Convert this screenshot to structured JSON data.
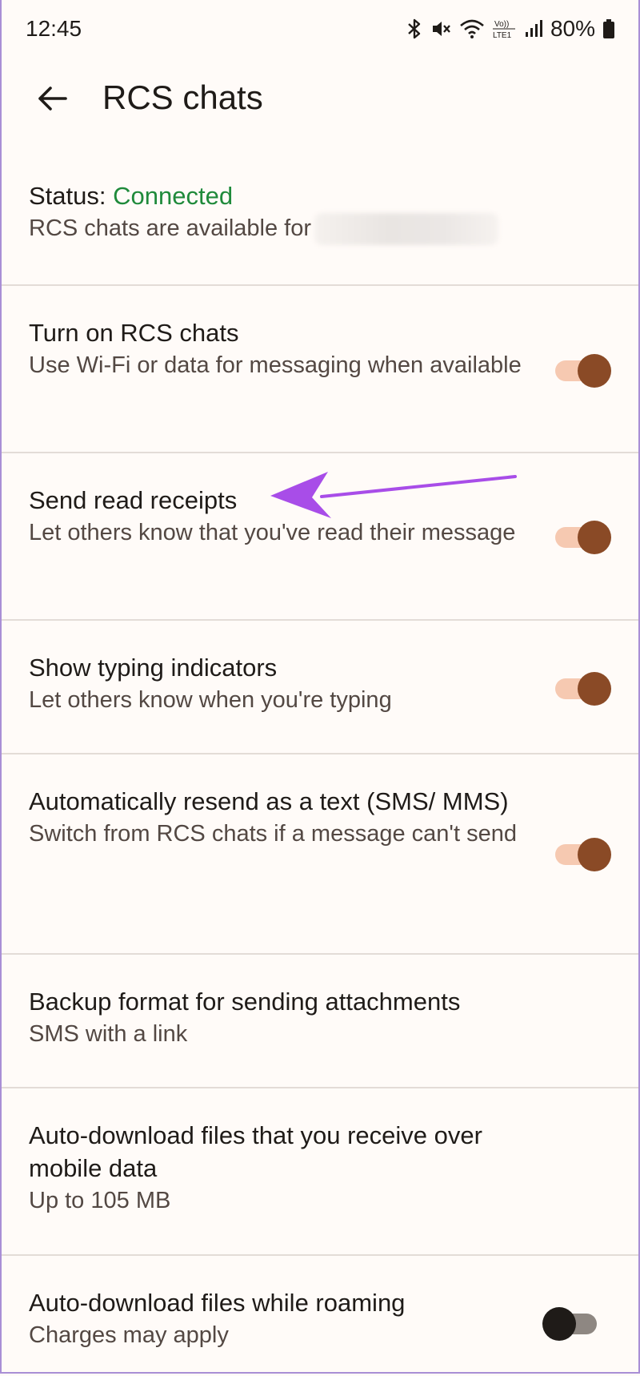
{
  "status_bar": {
    "time": "12:45",
    "icons": [
      "bluetooth-icon",
      "mute-icon",
      "wifi-icon",
      "volte-icon",
      "signal-icon"
    ],
    "battery": "80%"
  },
  "app_bar": {
    "back_icon": "arrow-left-icon",
    "title": "RCS chats"
  },
  "status": {
    "label": "Status: ",
    "value": "Connected",
    "value_color": "#1f8a3b",
    "description": "RCS chats are available for"
  },
  "settings": [
    {
      "title": "Turn on RCS chats",
      "subtitle": "Use Wi-Fi or data for messaging when available",
      "toggle": true
    },
    {
      "title": "Send read receipts",
      "subtitle": "Let others know that you've read their message",
      "toggle": true
    },
    {
      "title": "Show typing indicators",
      "subtitle": "Let others know when you're typing",
      "toggle": true
    },
    {
      "title": "Automatically resend as a text (SMS/ MMS)",
      "subtitle": "Switch from RCS chats if a message can't send",
      "toggle": true
    },
    {
      "title": "Backup format for sending attachments",
      "subtitle": "SMS with a link"
    },
    {
      "title": "Auto-download files that you receive over mobile data",
      "subtitle": "Up to 105 MB"
    },
    {
      "title": "Auto-download files while roaming",
      "subtitle": "Charges may apply",
      "toggle": false
    }
  ],
  "colors": {
    "accent_thumb": "#8a4a26",
    "accent_track": "#f6c9b1",
    "annotation": "#a84de8"
  }
}
